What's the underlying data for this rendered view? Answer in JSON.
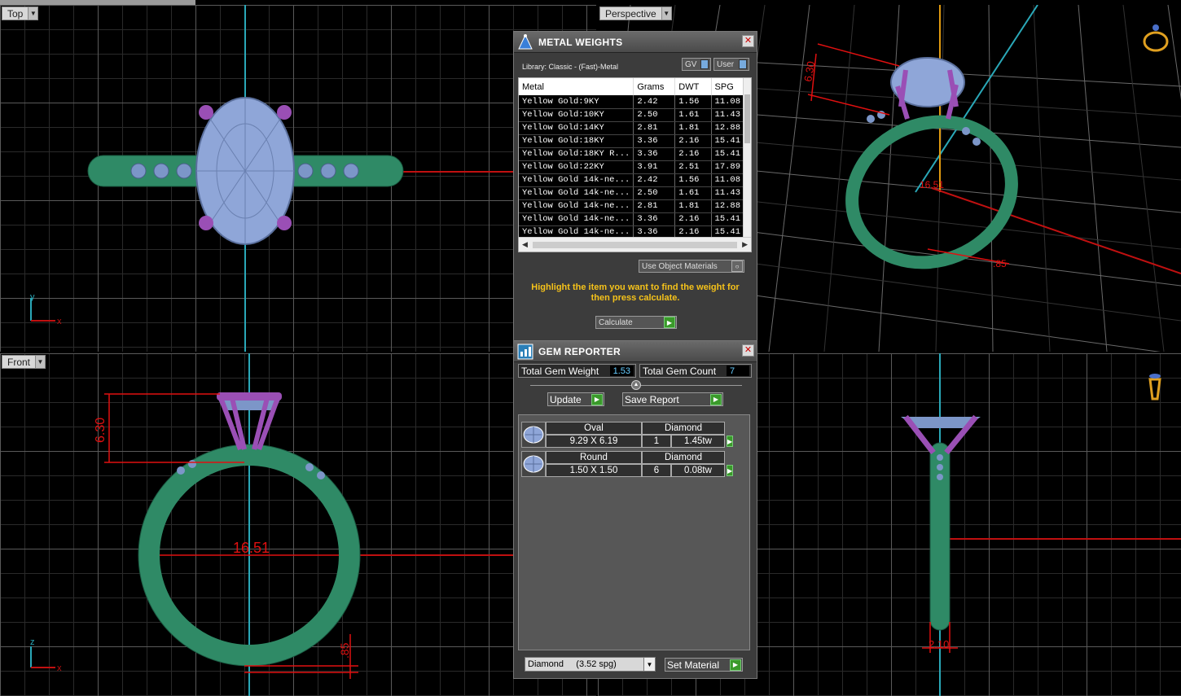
{
  "viewports": {
    "top": {
      "label": "Top"
    },
    "perspective": {
      "label": "Perspective"
    },
    "front": {
      "label": "Front"
    }
  },
  "dimensions": {
    "front_height": "6.30",
    "front_width": "16.51",
    "front_bottom": ".85",
    "persp_height": "6.30",
    "persp_width": "16.51",
    "persp_bottom": ".85",
    "side_width": "2.10"
  },
  "axes": {
    "top_y": "y",
    "top_x": "x",
    "front_z": "z",
    "front_x": "x"
  },
  "metal_weights": {
    "title": "METAL WEIGHTS",
    "library": "Library: Classic - (Fast)-Metal",
    "gv_label": "GV",
    "user_label": "User",
    "columns": [
      "Metal",
      "Grams",
      "DWT",
      "SPG"
    ],
    "rows": [
      [
        "Yellow Gold:9KY",
        "2.42",
        "1.56",
        "11.08"
      ],
      [
        "Yellow Gold:10KY",
        "2.50",
        "1.61",
        "11.43"
      ],
      [
        "Yellow Gold:14KY",
        "2.81",
        "1.81",
        "12.88"
      ],
      [
        "Yellow Gold:18KY",
        "3.36",
        "2.16",
        "15.41"
      ],
      [
        "Yellow Gold:18KY R...",
        "3.36",
        "2.16",
        "15.41"
      ],
      [
        "Yellow Gold:22KY",
        "3.91",
        "2.51",
        "17.89"
      ],
      [
        "Yellow Gold 14k-ne...",
        "2.42",
        "1.56",
        "11.08"
      ],
      [
        "Yellow Gold 14k-ne...",
        "2.50",
        "1.61",
        "11.43"
      ],
      [
        "Yellow Gold 14k-ne...",
        "2.81",
        "1.81",
        "12.88"
      ],
      [
        "Yellow Gold 14k-ne...",
        "3.36",
        "2.16",
        "15.41"
      ],
      [
        "Yellow Gold 14k-ne...",
        "3.36",
        "2.16",
        "15.41"
      ]
    ],
    "use_object_materials": "Use Object Materials",
    "hint": "Highlight the item you want to find the weight for then press calculate.",
    "calculate_label": "Calculate"
  },
  "gem_reporter": {
    "title": "GEM REPORTER",
    "total_weight_label": "Total Gem Weight",
    "total_weight": "1.53",
    "total_count_label": "Total Gem Count",
    "total_count": "7",
    "update_label": "Update",
    "save_label": "Save Report",
    "gems": [
      {
        "shape": "Oval",
        "material": "Diamond",
        "size": "9.29 X 6.19",
        "qty": "1",
        "weight": "1.45tw"
      },
      {
        "shape": "Round",
        "material": "Diamond",
        "size": "1.50 X 1.50",
        "qty": "6",
        "weight": "0.08tw"
      }
    ],
    "material_select": "Diamond     (3.52 spg)",
    "set_material_label": "Set Material"
  },
  "colors": {
    "band": "#2f8a66",
    "prong": "#9a4fb5",
    "gem": "#8fa6d8",
    "dimension": "#e01010",
    "axis_cyan": "#2aa8b8",
    "highlight": "#f5c21a"
  }
}
